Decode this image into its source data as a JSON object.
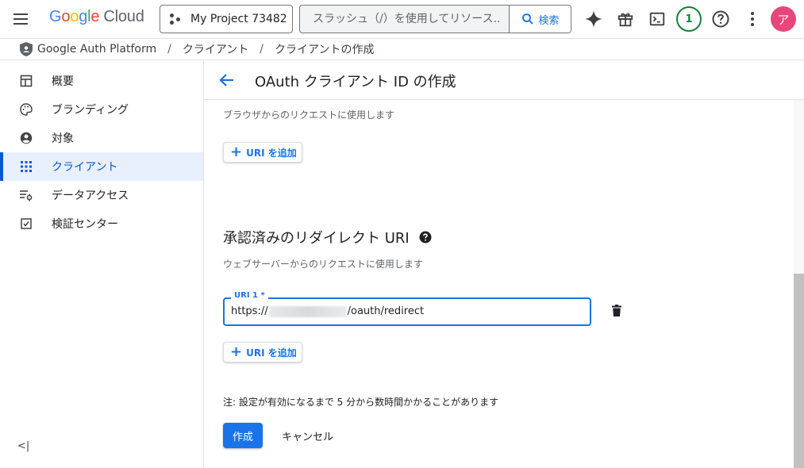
{
  "header": {
    "logo": {
      "g": "G",
      "o1": "o",
      "o2": "o",
      "g2": "g",
      "l": "l",
      "e": "e",
      "cloud": "Cloud"
    },
    "project": "My Project 73482",
    "search": {
      "placeholder": "スラッシュ（/）を使用してリソース...",
      "button": "検索"
    },
    "notifications": "1",
    "avatar": "ア",
    "icons": [
      "menu-icon",
      "sparkle-icon",
      "gift-icon",
      "terminal-icon",
      "help-icon",
      "more-vert-icon"
    ]
  },
  "breadcrumb": {
    "items": [
      "Google Auth Platform",
      "クライアント",
      "クライアントの作成"
    ],
    "separator": "/"
  },
  "sidebar": {
    "items": [
      {
        "label": "概要",
        "icon": "dashboard-icon"
      },
      {
        "label": "ブランディング",
        "icon": "palette-icon"
      },
      {
        "label": "対象",
        "icon": "account-circle-icon"
      },
      {
        "label": "クライアント",
        "icon": "apps-grid-icon",
        "active": true
      },
      {
        "label": "データアクセス",
        "icon": "settings-list-icon"
      },
      {
        "label": "検証センター",
        "icon": "verified-checkbox-icon"
      }
    ],
    "collapse": "<|"
  },
  "main": {
    "title": "OAuth クライアント ID の作成",
    "origins_helper": "ブラウザからのリクエストに使用します",
    "add_uri_label": "URI を追加",
    "redirect_section_title": "承認済みのリダイレクト URI",
    "redirect_helper": "ウェブサーバーからのリクエストに使用します",
    "uri_field": {
      "label": "URI 1 *",
      "prefix": "https://",
      "suffix": "/oauth/redirect"
    },
    "note": "注: 設定が有効になるまで 5 分から数時間かかることがあります",
    "create_button": "作成",
    "cancel_button": "キャンセル"
  },
  "colors": {
    "accent": "#1a73e8",
    "active_bg": "#e8f0fe",
    "avatar": "#e8457a",
    "badge": "#188038"
  }
}
